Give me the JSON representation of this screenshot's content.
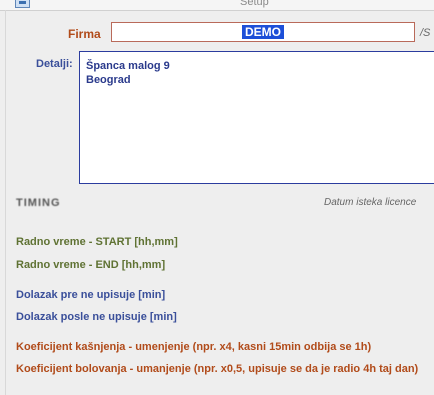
{
  "window": {
    "title": "Setup"
  },
  "form": {
    "firma_label": "Firma",
    "firma_value": "DEMO",
    "firma_trailing": "/S",
    "detalji_label": "Detalji:",
    "detalji_lines": [
      "Španca malog 9",
      "Beograd"
    ],
    "section_label": "TIMING",
    "section_hint": "Datum isteka licence",
    "radno_start": "Radno vreme - START [hh,mm]",
    "radno_end": "Radno vreme - END [hh,mm]",
    "dolazak_pre": "Dolazak pre ne upisuje [min]",
    "dolazak_posle": "Dolazak posle ne upisuje [min]",
    "koef_kasnjenja": "Koeficijent kašnjenja - umenjenje (npr. x4, kasni 15min odbija  se 1h)",
    "koef_bolovanja": "Koeficijent bolovanja - umanjenje (npr. x0,5, upisuje se da je radio 4h taj dan)"
  },
  "colors": {
    "field_label": "#b14b1a",
    "detalji_border": "#2b3c9e",
    "selection": "#1d4fd8",
    "green_label": "#5f7233",
    "blue_label": "#3a4f9a"
  }
}
